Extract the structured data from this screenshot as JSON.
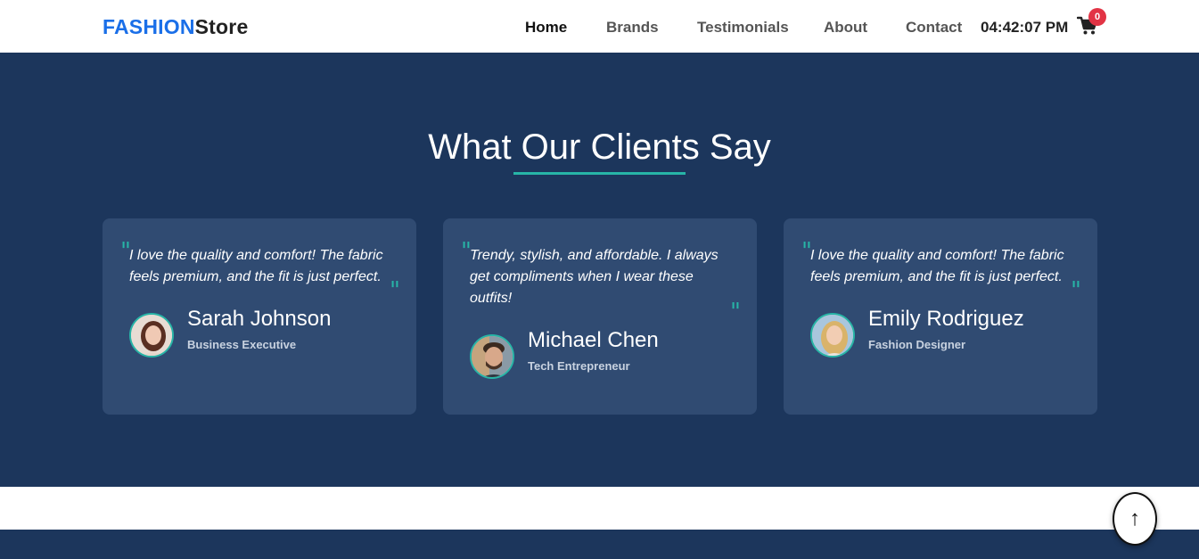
{
  "brand": {
    "part1": "FASHION",
    "part2": "Store",
    "accent_color": "#1a6fe8"
  },
  "nav": {
    "items": [
      {
        "label": "Home",
        "active": true
      },
      {
        "label": "Brands",
        "active": false
      },
      {
        "label": "Testimonials",
        "active": false
      },
      {
        "label": "About",
        "active": false
      },
      {
        "label": "Contact",
        "active": false
      }
    ],
    "clock": "04:42:07 PM",
    "cart": {
      "icon": "cart-icon",
      "count": "0"
    }
  },
  "testimonials": {
    "title": "What Our Clients Say",
    "background_color": "#1c365c",
    "card_color": "#304b72",
    "accent_color": "#27b5a7",
    "items": [
      {
        "quote": "I love the quality and comfort! The fabric feels premium, and the fit is just perfect.",
        "name": "Sarah Johnson",
        "role": "Business Executive"
      },
      {
        "quote": "Trendy, stylish, and affordable. I always get compliments when I wear these outfits!",
        "name": "Michael Chen",
        "role": "Tech Entrepreneur"
      },
      {
        "quote": "I love the quality and comfort! The fabric feels premium, and the fit is just perfect.",
        "name": "Emily Rodriguez",
        "role": "Fashion Designer"
      }
    ]
  },
  "scroll_top": {
    "icon": "arrow-up-icon",
    "label": "↑"
  }
}
